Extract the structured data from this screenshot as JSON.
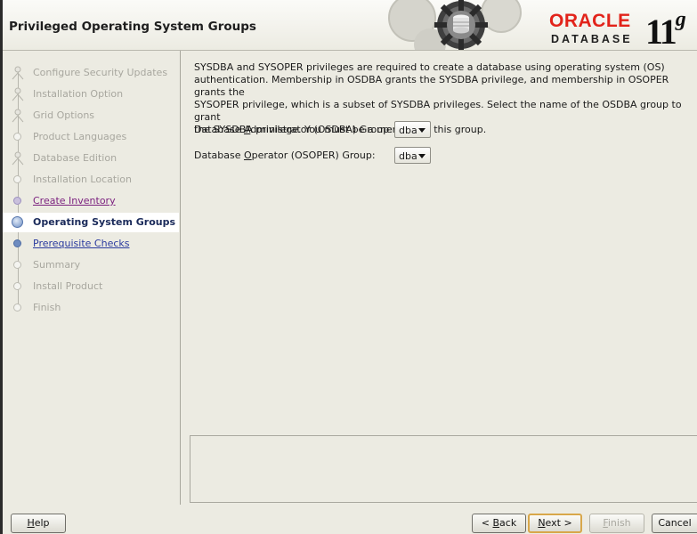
{
  "window": {
    "title": "Privileged Operating System Groups"
  },
  "brand": {
    "oracle": "ORACLE",
    "database": "DATABASE",
    "version": "11",
    "version_suffix": "g",
    "red": "#e2231a"
  },
  "steps": [
    {
      "label": "Configure Security Updates",
      "state": "inactive",
      "icon": "person-icon"
    },
    {
      "label": "Installation Option",
      "state": "inactive",
      "icon": "person-icon"
    },
    {
      "label": "Grid Options",
      "state": "inactive",
      "icon": "person-icon"
    },
    {
      "label": "Product Languages",
      "state": "inactive",
      "icon": "dot-icon"
    },
    {
      "label": "Database Edition",
      "state": "inactive",
      "icon": "person-icon"
    },
    {
      "label": "Installation Location",
      "state": "inactive",
      "icon": "dot-icon"
    },
    {
      "label": "Create Inventory",
      "state": "visited-link",
      "icon": "dot-icon"
    },
    {
      "label": "Operating System Groups",
      "state": "current",
      "icon": "dot-icon"
    },
    {
      "label": "Prerequisite Checks",
      "state": "link",
      "icon": "dot-icon"
    },
    {
      "label": "Summary",
      "state": "inactive",
      "icon": "dot-icon"
    },
    {
      "label": "Install Product",
      "state": "inactive",
      "icon": "dot-icon"
    },
    {
      "label": "Finish",
      "state": "inactive",
      "icon": "dot-icon"
    }
  ],
  "main": {
    "description_lines": [
      "SYSDBA and SYSOPER privileges are required to create a database using operating system (OS)",
      "authentication. Membership in OSDBA grants the SYSDBA privilege, and membership in OSOPER grants the",
      "SYSOPER privilege, which is a subset of SYSDBA privileges. Select the name of the OSDBA group to grant",
      "the SYSDBA privilege. You must be a member of this group."
    ],
    "osdba": {
      "label_pre": "Database ",
      "label_mnemonic": "A",
      "label_post": "dministrator (OSDBA) Group:",
      "value": "dba"
    },
    "osoper": {
      "label_pre": "Database ",
      "label_mnemonic": "O",
      "label_post": "perator (OSOPER) Group:",
      "value": "dba"
    }
  },
  "buttons": {
    "help": {
      "mnemonic": "H",
      "rest": "elp"
    },
    "back": {
      "pre": "< ",
      "mnemonic": "B",
      "rest": "ack"
    },
    "next": {
      "mnemonic": "N",
      "rest": "ext >"
    },
    "finish": {
      "mnemonic": "F",
      "rest": "inish"
    },
    "cancel": {
      "label": "Cancel"
    }
  }
}
